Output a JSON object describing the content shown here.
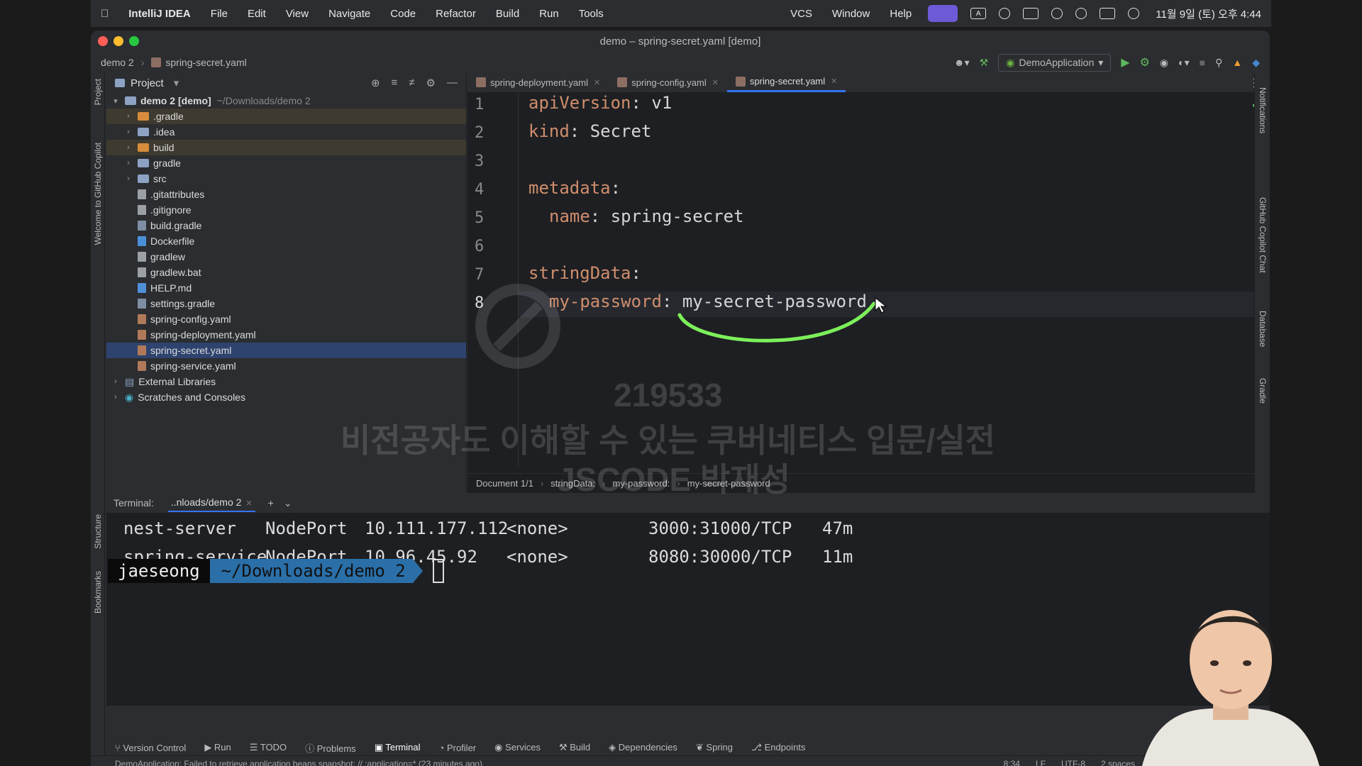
{
  "menubar": {
    "app": "IntelliJ IDEA",
    "items": [
      "File",
      "Edit",
      "View",
      "Navigate",
      "Code",
      "Refactor",
      "Build",
      "Run",
      "Tools"
    ],
    "right_items": [
      "VCS",
      "Window",
      "Help"
    ],
    "clock": "11월 9일 (토) 오후 4:44"
  },
  "window": {
    "title": "demo – spring-secret.yaml [demo]",
    "breadcrumb_project": "demo 2",
    "breadcrumb_file": "spring-secret.yaml",
    "run_config": "DemoApplication"
  },
  "project": {
    "header": "Project",
    "root_name": "demo 2",
    "root_module": "[demo]",
    "root_path": "~/Downloads/demo 2",
    "items": [
      {
        "label": ".gradle"
      },
      {
        "label": ".idea"
      },
      {
        "label": "build"
      },
      {
        "label": "gradle"
      },
      {
        "label": "src"
      },
      {
        "label": ".gitattributes"
      },
      {
        "label": ".gitignore"
      },
      {
        "label": "build.gradle"
      },
      {
        "label": "Dockerfile"
      },
      {
        "label": "gradlew"
      },
      {
        "label": "gradlew.bat"
      },
      {
        "label": "HELP.md"
      },
      {
        "label": "settings.gradle"
      },
      {
        "label": "spring-config.yaml"
      },
      {
        "label": "spring-deployment.yaml"
      },
      {
        "label": "spring-secret.yaml"
      },
      {
        "label": "spring-service.yaml"
      }
    ],
    "external_libraries": "External Libraries",
    "scratches": "Scratches and Consoles"
  },
  "editor": {
    "tabs": [
      "spring-deployment.yaml",
      "spring-config.yaml",
      "spring-secret.yaml"
    ],
    "lines": [
      {
        "num": "1",
        "key": "apiVersion",
        "value": "v1"
      },
      {
        "num": "2",
        "key": "kind",
        "value": "Secret"
      },
      {
        "num": "3",
        "key": "",
        "value": ""
      },
      {
        "num": "4",
        "key": "metadata",
        "value": ""
      },
      {
        "num": "5",
        "key": "name",
        "value": "spring-secret"
      },
      {
        "num": "6",
        "key": "",
        "value": ""
      },
      {
        "num": "7",
        "key": "stringData",
        "value": ""
      },
      {
        "num": "8",
        "key": "my-password",
        "value": "my-secret-password"
      }
    ],
    "breadcrumbs": [
      "Document 1/1",
      "stringData:",
      "my-password:",
      "my-secret-password"
    ]
  },
  "watermark": {
    "id": "219533",
    "line1": "비전공자도 이해할 수 있는 쿠버네티스 입문/실전",
    "line2": "JSCODE 박재성"
  },
  "terminal": {
    "label": "Terminal:",
    "tab": "..nloads/demo 2",
    "rows": [
      {
        "name": "nest-server",
        "type": "NodePort",
        "ip": "10.111.177.112",
        "ext": "<none>",
        "ports": "3000:31000/TCP",
        "age": "47m"
      },
      {
        "name": "spring-service",
        "type": "NodePort",
        "ip": "10.96.45.92",
        "ext": "<none>",
        "ports": "8080:30000/TCP",
        "age": "11m"
      }
    ],
    "prompt_user": "jaeseong",
    "prompt_path": "~/Downloads/demo 2"
  },
  "bottom_tabs": [
    "Version Control",
    "Run",
    "TODO",
    "Problems",
    "Terminal",
    "Profiler",
    "Services",
    "Build",
    "Dependencies",
    "Spring",
    "Endpoints"
  ],
  "status": {
    "message": "DemoApplication: Failed to retrieve application beans snapshot: // :application=* (23 minutes ago)",
    "position": "8:34",
    "line_sep": "LF",
    "encoding": "UTF-8",
    "indent": "2 spaces"
  },
  "side_labels": {
    "project": "Project",
    "copilot": "Welcome to GitHub Copilot",
    "structure": "Structure",
    "bookmarks": "Bookmarks",
    "notifications": "Notifications",
    "copilot_chat": "GitHub Copilot Chat",
    "database": "Database",
    "gradle": "Gradle"
  },
  "colors": {
    "accent": "#3574f0",
    "yaml_key": "#cf8e6d",
    "annotation": "#7cf05a"
  }
}
